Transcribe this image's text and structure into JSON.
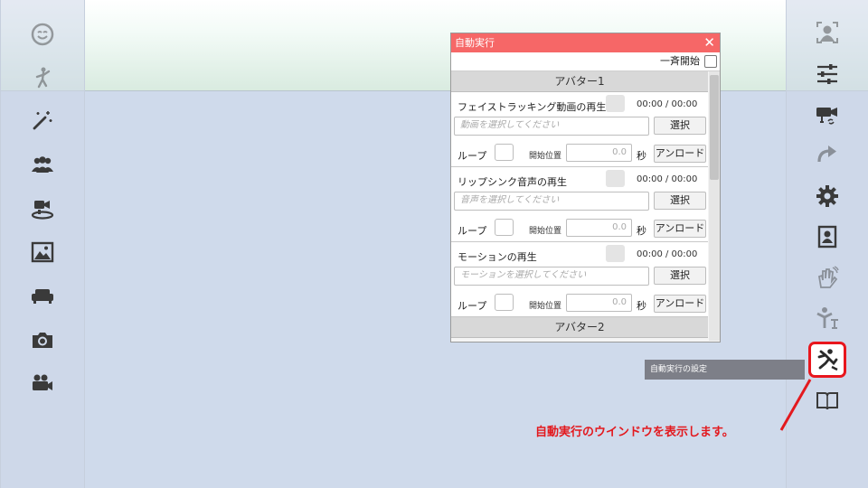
{
  "window": {
    "title": "自動実行",
    "close_glyph": "✕",
    "all_start_label": "一斉開始",
    "avatar1_header": "アバター1",
    "avatar2_header": "アバター2",
    "sections": [
      {
        "title": "フェイストラッキング動画の再生",
        "time": "00:00 / 00:00",
        "placeholder": "動画を選択してください",
        "select_label": "選択",
        "loop_label": "ループ",
        "start_label": "開始位置",
        "start_value": "0.0",
        "unit": "秒",
        "unload_label": "アンロード"
      },
      {
        "title": "リップシンク音声の再生",
        "time": "00:00 / 00:00",
        "placeholder": "音声を選択してください",
        "select_label": "選択",
        "loop_label": "ループ",
        "start_label": "開始位置",
        "start_value": "0.0",
        "unit": "秒",
        "unload_label": "アンロード"
      },
      {
        "title": "モーションの再生",
        "time": "00:00 / 00:00",
        "placeholder": "モーションを選択してください",
        "select_label": "選択",
        "loop_label": "ループ",
        "start_label": "開始位置",
        "start_value": "0.0",
        "unit": "秒",
        "unload_label": "アンロード"
      }
    ]
  },
  "tooltip": "自動実行の設定",
  "callout": "自動実行のウインドウを表示します。",
  "left_sidebar_icons": [
    "face-icon",
    "dance-icon",
    "magic-wand-icon",
    "group-icon",
    "camera-stage-icon",
    "image-icon",
    "sofa-icon",
    "camera-icon",
    "video-camera-icon"
  ],
  "right_sidebar_icons": [
    "face-tracking-icon",
    "sliders-icon",
    "video-camera-sync-icon",
    "redo-icon",
    "gear-icon",
    "portrait-icon",
    "wave-hand-icon",
    "pose-icon",
    "auto-run-icon",
    "book-icon"
  ],
  "colors": {
    "title_bar": "#f66767",
    "highlight": "#e8161d",
    "callout_text": "#e3191e",
    "icon": "#3a3a3a"
  }
}
